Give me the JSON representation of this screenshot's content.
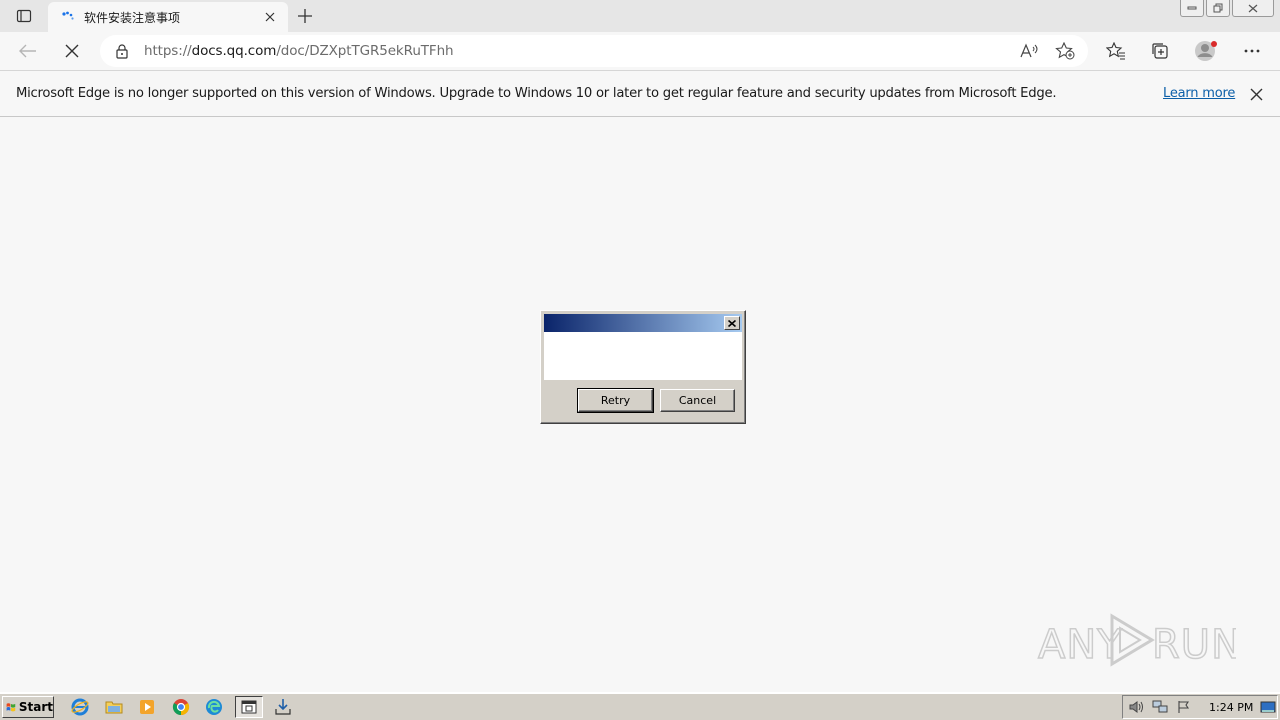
{
  "tab": {
    "title": "软件安装注意事项"
  },
  "toolbar": {
    "url_prefix": "https://",
    "url_host": "docs.qq.com",
    "url_path": "/doc/DZXptTGR5ekRuTFhh"
  },
  "infobar": {
    "message": "Microsoft Edge is no longer supported on this version of Windows. Upgrade to Windows 10 or later to get regular feature and security updates from Microsoft Edge.",
    "link": "Learn more"
  },
  "dialog": {
    "title": "",
    "message": "",
    "retry_label": "Retry",
    "cancel_label": "Cancel"
  },
  "taskbar": {
    "start_label": "Start",
    "clock": "1:24 PM",
    "quick_launch": [
      "ie-icon",
      "explorer-icon",
      "media-player-icon",
      "chrome-icon",
      "edge-icon",
      "task-icon",
      "download-icon"
    ]
  },
  "watermark": {
    "text": "ANY RUN"
  },
  "colors": {
    "title_gradient_start": "#0a246a",
    "title_gradient_end": "#a6caf0",
    "link": "#0c5fa8",
    "classic_gray": "#d4d0c8"
  }
}
